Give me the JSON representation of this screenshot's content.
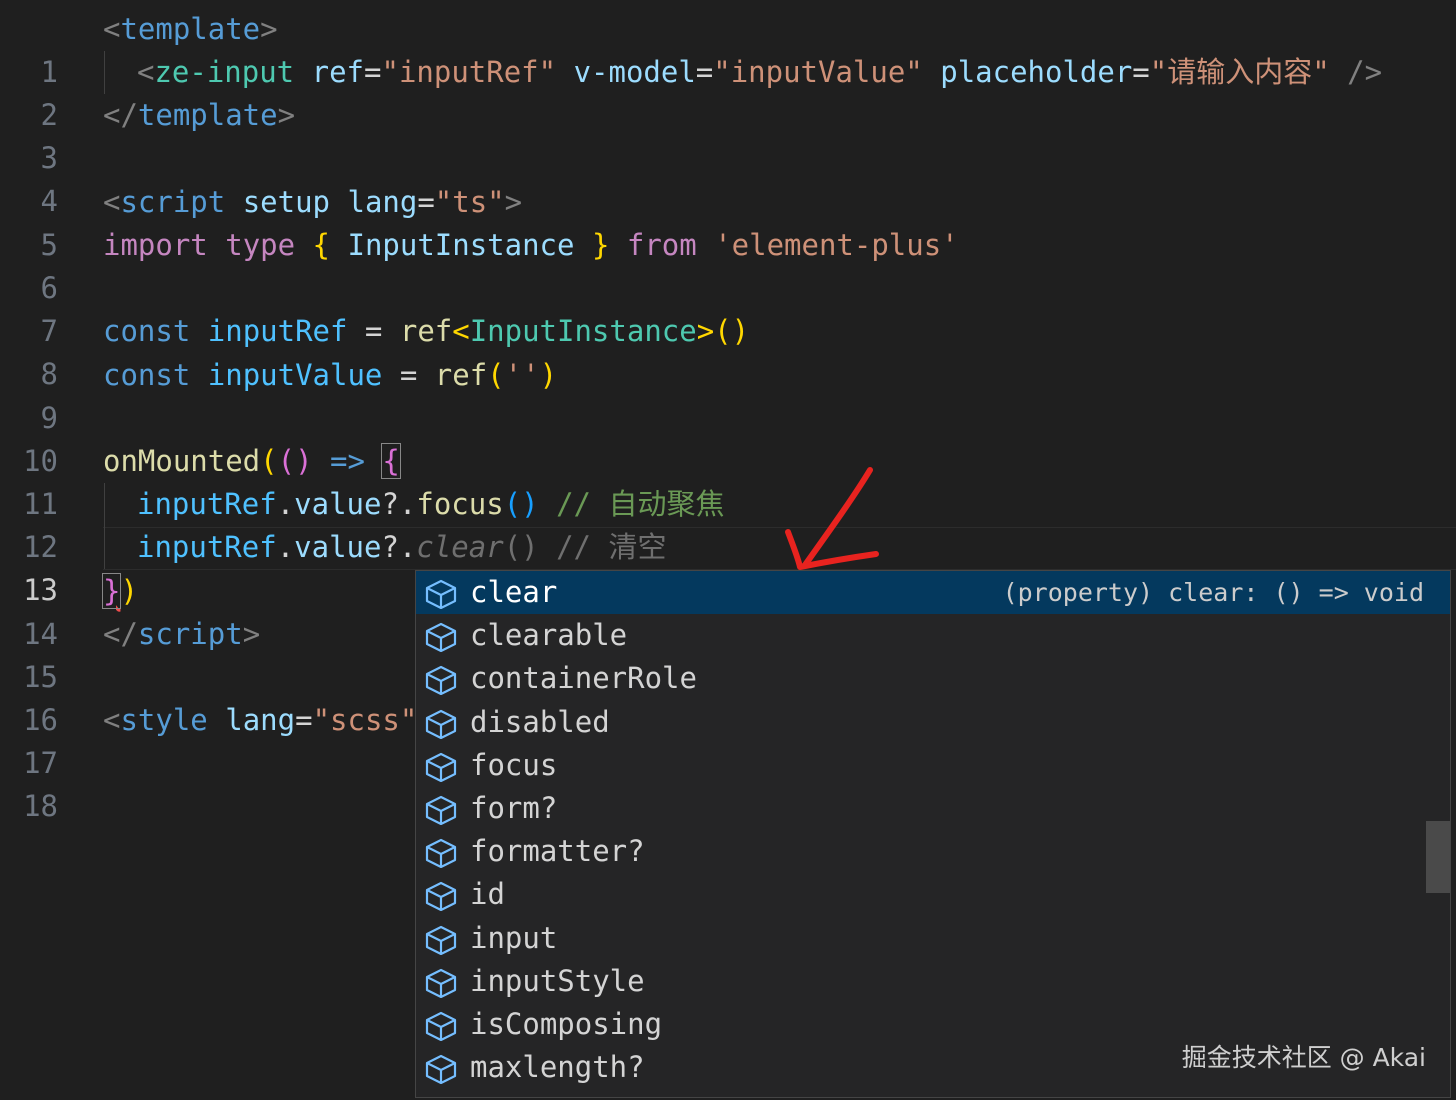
{
  "editor": {
    "line_numbers": [
      "1",
      "2",
      "3",
      "4",
      "5",
      "6",
      "7",
      "8",
      "9",
      "10",
      "11",
      "12",
      "13",
      "14",
      "15",
      "16",
      "17",
      "18"
    ],
    "active_line": "13",
    "code": {
      "l1": {
        "a": "<",
        "b": "template",
        "c": ">"
      },
      "l2": {
        "a": "<",
        "b": "ze-input",
        "c": " ",
        "d": "ref",
        "e": "=",
        "f": "\"inputRef\"",
        "g": " ",
        "h": "v-model",
        "i": "=",
        "j": "\"inputValue\"",
        "k": " ",
        "l": "placeholder",
        "m": "=",
        "n": "\"请输入内容\"",
        "o": " />"
      },
      "l3": {
        "a": "</",
        "b": "template",
        "c": ">"
      },
      "l5": {
        "a": "<",
        "b": "script",
        "c": " ",
        "d": "setup",
        "e": " ",
        "f": "lang",
        "g": "=",
        "h": "\"ts\"",
        "i": ">"
      },
      "l6": {
        "a": "import",
        "b": " ",
        "c": "type",
        "d": " ",
        "e": "{",
        "f": " ",
        "g": "InputInstance",
        "h": " ",
        "i": "}",
        "j": " ",
        "k": "from",
        "l": " ",
        "m": "'element-plus'"
      },
      "l8": {
        "a": "const",
        "b": " ",
        "c": "inputRef",
        "d": " = ",
        "e": "ref",
        "f": "<",
        "g": "InputInstance",
        "h": ">",
        "i": "()"
      },
      "l9": {
        "a": "const",
        "b": " ",
        "c": "inputValue",
        "d": " = ",
        "e": "ref",
        "f": "(",
        "g": "''",
        "h": ")"
      },
      "l11": {
        "a": "onMounted",
        "b": "(",
        "c": "()",
        "d": " ",
        "e": "=>",
        "f": " ",
        "g": "{"
      },
      "l12": {
        "a": "inputRef",
        "b": ".",
        "c": "value",
        "d": "?.",
        "e": "focus",
        "f": "()",
        "g": " // 自动聚焦"
      },
      "l13": {
        "a": "inputRef",
        "b": ".",
        "c": "value",
        "d": "?.",
        "e": "clear",
        "f": "()",
        "g": " // 清空"
      },
      "l14": {
        "a": "}",
        "b": ")"
      },
      "l15": {
        "a": "</",
        "b": "script",
        "c": ">"
      },
      "l17": {
        "a": "<",
        "b": "style",
        "c": " ",
        "d": "lang",
        "e": "=",
        "f": "\"scss\""
      }
    }
  },
  "suggest": {
    "items": [
      {
        "label": "clear",
        "detail": "(property) clear: () => void",
        "icon": "property-cube-icon",
        "selected": true
      },
      {
        "label": "clearable",
        "icon": "property-cube-icon"
      },
      {
        "label": "containerRole",
        "icon": "property-cube-icon"
      },
      {
        "label": "disabled",
        "icon": "property-cube-icon"
      },
      {
        "label": "focus",
        "icon": "property-cube-icon"
      },
      {
        "label": "form?",
        "icon": "property-cube-icon"
      },
      {
        "label": "formatter?",
        "icon": "property-cube-icon"
      },
      {
        "label": "id",
        "icon": "property-cube-icon"
      },
      {
        "label": "input",
        "icon": "property-cube-icon"
      },
      {
        "label": "inputStyle",
        "icon": "property-cube-icon"
      },
      {
        "label": "isComposing",
        "icon": "property-cube-icon"
      },
      {
        "label": "maxlength?",
        "icon": "property-cube-icon"
      }
    ]
  },
  "annotation": {
    "arrow_color": "#e8231f",
    "icon": "red-arrow-icon"
  },
  "watermark": {
    "text": "掘金技术社区 @ Akai"
  },
  "colors": {
    "background": "#1f1f1f",
    "selection": "#04395e",
    "widget_bg": "#252526"
  }
}
